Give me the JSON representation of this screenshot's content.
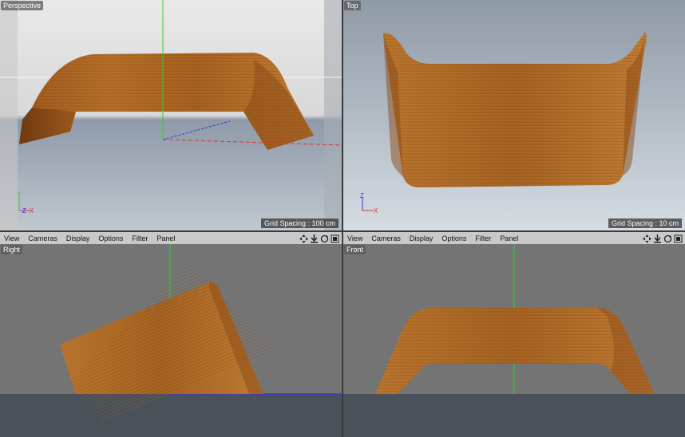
{
  "viewports": {
    "perspective": {
      "title": "Perspective",
      "grid_label": "Grid Spacing : 100 cm"
    },
    "top": {
      "title": "Top",
      "grid_label": "Grid Spacing : 10 cm"
    },
    "right": {
      "title": "Right"
    },
    "front": {
      "title": "Front"
    }
  },
  "menu": [
    "View",
    "Cameras",
    "Display",
    "Options",
    "Filter",
    "Panel"
  ],
  "axis_labels": {
    "y": "Y",
    "z": "Z",
    "x": "X"
  },
  "icons": [
    "move-icon",
    "zoom-icon",
    "rotate-icon",
    "maximize-icon"
  ],
  "colors": {
    "wood_dark": "#7a3f12",
    "wood_mid": "#a8621f",
    "wood_light": "#c98a3d",
    "axis_green": "#33cc33",
    "axis_red": "#dd3333",
    "axis_blue": "#3333dd"
  }
}
